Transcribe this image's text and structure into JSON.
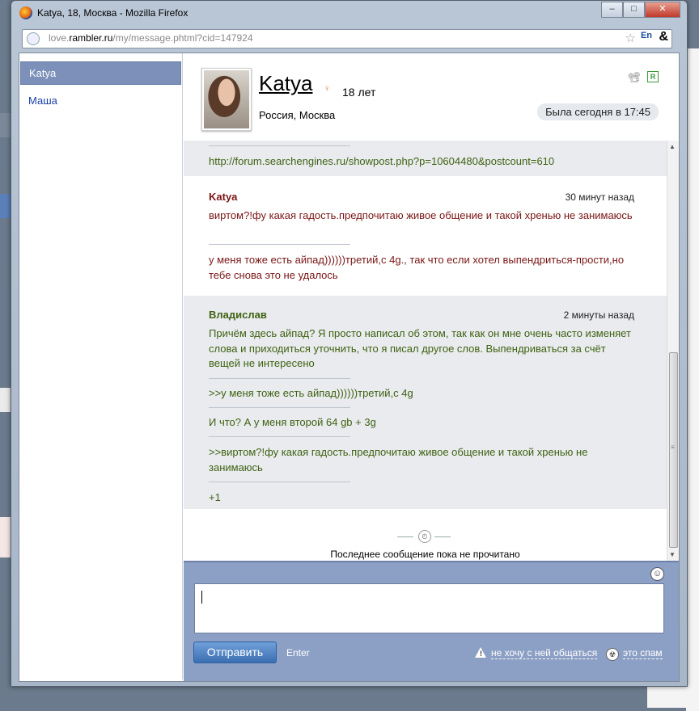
{
  "window": {
    "title": "Katya, 18, Москва - Mozilla Firefox",
    "url_prefix": "love.",
    "url_host": "rambler.ru",
    "url_path": "/my/message.phtml?cid=147924",
    "lang_badge": "En",
    "amp_glyph": "&",
    "btn_min": "–",
    "btn_max": "□",
    "btn_close": "✕"
  },
  "sidebar": {
    "items": [
      {
        "label": "Katya",
        "active": true
      },
      {
        "label": "Маша",
        "active": false
      }
    ]
  },
  "profile": {
    "name": "Katya",
    "age": "18 лет",
    "location": "Россия, Москва",
    "status": "Была сегодня в 17:45",
    "badge_r": "R",
    "gender_glyph": "♀"
  },
  "messages": [
    {
      "sender": "",
      "time": "",
      "color": "green",
      "parts": [
        "http://forum.searchengines.ru/showpost.php?p=10604480&postcount=610"
      ]
    },
    {
      "sender": "Katya",
      "time": "30 минут назад",
      "color": "red",
      "parts": [
        "виртом?!фу какая гадость.предпочитаю живое общение и такой хренью не занимаюсь",
        "у меня тоже есть айпад))))))третий,с 4g., так что если хотел выпендриться-прости,но тебе снова это не удалось"
      ]
    },
    {
      "sender": "Владислав",
      "time": "2 минуты назад",
      "color": "green",
      "parts": [
        "Причём здесь айпад? Я просто написал об этом, так как он мне очень часто изменяет слова и приходиться уточнить, что я писал другое слов. Выпендриваться за счёт вещей не интересено",
        ">>у меня тоже есть айпад))))))третий,с 4g",
        "И что? А у меня второй 64 gb + 3g",
        ">>виртом?!фу какая гадость.предпочитаю живое общение и такой хренью не занимаюсь",
        "+1"
      ]
    }
  ],
  "unread_notice": "Последнее сообщение пока не прочитано",
  "composer": {
    "send_label": "Отправить",
    "enter_hint": "Enter",
    "block_link": "не хочу с ней общаться",
    "spam_link": "это спам"
  },
  "colors": {
    "sidebar_active": "#7c90b9",
    "composer_bg": "#8c9fc4",
    "incoming_text": "#7a1515",
    "outgoing_text": "#3f6212"
  }
}
